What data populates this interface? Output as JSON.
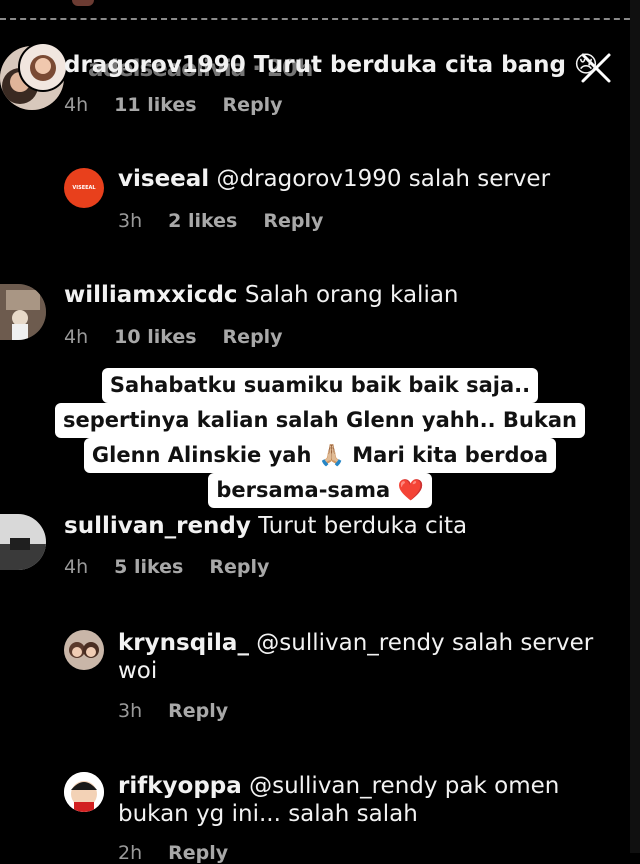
{
  "close_label": "close",
  "comments": [
    {
      "username": "dragorov1990",
      "text": "Turut berduka cita bang",
      "emoji": "😢",
      "ghost_text": "adelseaolivia · 20h",
      "time": "4h",
      "likes": "11 likes",
      "reply": "Reply"
    },
    {
      "username": "viseeal",
      "text": "@dragorov1990 salah server",
      "time": "3h",
      "likes": "2 likes",
      "reply": "Reply",
      "avatar_label": "VISEEAL"
    },
    {
      "username": "williamxxicdc",
      "text": "Salah orang kalian",
      "time": "4h",
      "likes": "10 likes",
      "reply": "Reply"
    },
    {
      "username": "sullivan_rendy",
      "text": "Turut berduka cita",
      "time": "4h",
      "likes": "5 likes",
      "reply": "Reply"
    },
    {
      "username": "krynsqila_",
      "text_line1": "@sullivan_rendy salah server",
      "text_line2": "woi",
      "time": "3h",
      "reply": "Reply"
    },
    {
      "username": "rifkyoppa",
      "text_line1": "@sullivan_rendy pak omen",
      "text_line2": "bukan yg ini... salah salah",
      "time": "2h",
      "reply": "Reply"
    }
  ],
  "caption": {
    "lines": [
      "Sahabatku suamiku baik baik saja..",
      "sepertinya kalian salah Glenn yahh.. Bukan",
      "Glenn Alinskie yah 🙏🏼 Mari kita berdoa",
      "bersama-sama ❤️"
    ]
  },
  "colors": {
    "background": "#000000",
    "text": "#f2f2f2",
    "meta": "#9a9a9a",
    "caption_bg": "#ffffff",
    "viseeal_avatar": "#e8401c"
  }
}
